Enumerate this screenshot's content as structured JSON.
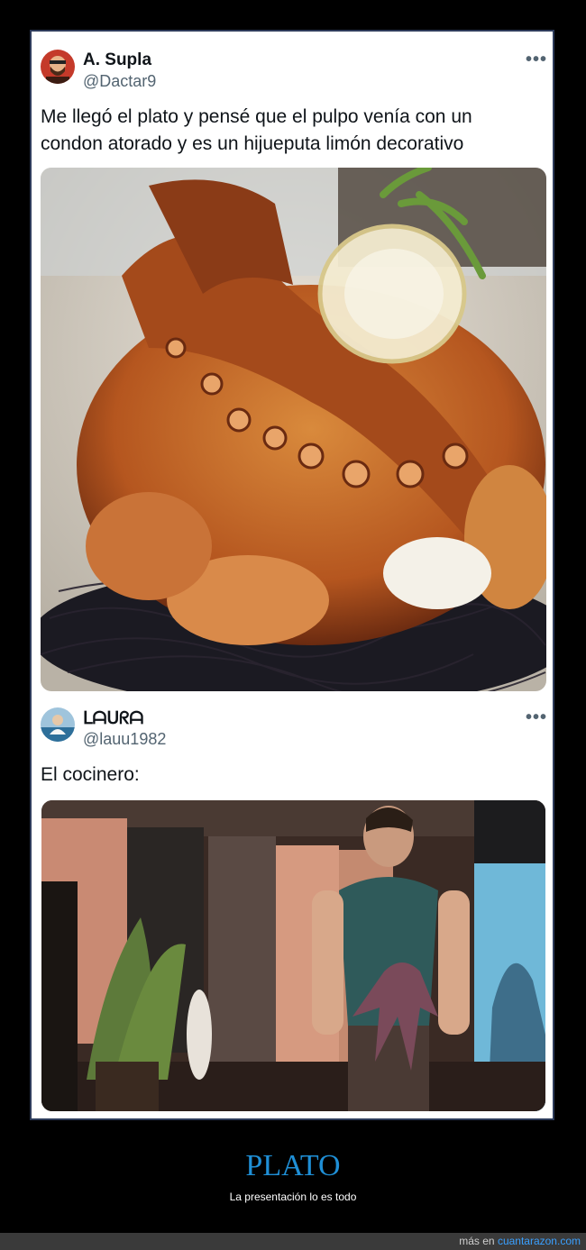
{
  "tweet1": {
    "name": "A. Supla",
    "handle": "@Dactar9",
    "more": "•••",
    "text_line1": "Me llegó el plato y pensé que el pulpo venía con un",
    "text_line2": "condon atorado y es un hijueputa limón decorativo"
  },
  "tweet2": {
    "name": "ᒪᗩᑌᖇᗩ",
    "handle": "@lauu1982",
    "more": "•••",
    "text": "El cocinero:"
  },
  "footer": {
    "title": "PLATO",
    "subtitle": "La presentación lo es todo",
    "more_prefix": "más en ",
    "more_link": "cuantarazon.com"
  },
  "colors": {
    "background": "#000000",
    "card": "#ffffff",
    "title_blue": "#1f8fd6",
    "link_blue": "#3aa0ff"
  }
}
